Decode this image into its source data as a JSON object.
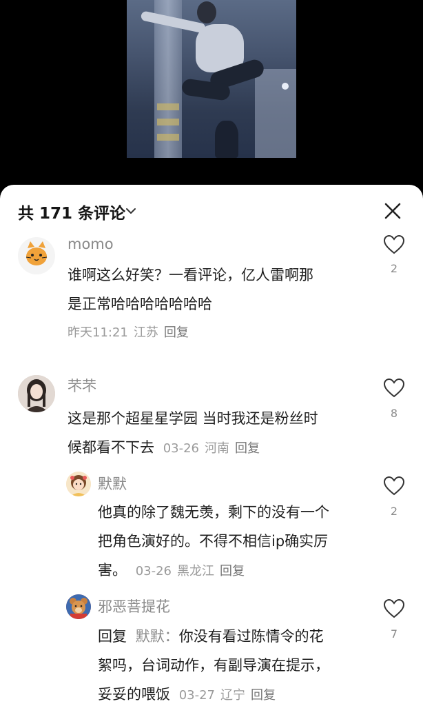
{
  "header": {
    "title": "共 171 条评论"
  },
  "comments": [
    {
      "name": "momo",
      "text_line1": "谁啊这么好笑？一看评论，亿人雷啊那",
      "text_line2": "是正常哈哈哈哈哈哈哈",
      "time": "昨天11:21",
      "location": "江苏",
      "reply": "回复",
      "likes": "2"
    },
    {
      "name": "芣芣",
      "text_line1": "这是那个超星星学园  当时我还是粉丝时",
      "text_line2": "候都看不下去",
      "time": "03-26",
      "location": "河南",
      "reply": "回复",
      "likes": "8"
    },
    {
      "name": "默默",
      "text_line1": "他真的除了魏无羡，剩下的没有一个",
      "text_line2": "把角色演好的。不得不相信ip确实厉",
      "text_line3": "害。",
      "time": "03-26",
      "location": "黑龙江",
      "reply": "回复",
      "likes": "2"
    },
    {
      "name": "邪恶菩提花",
      "reply_prefix": "回复",
      "reply_target": "默默：",
      "text_line1": "你没有看过陈情令的花",
      "text_line2": "絮吗，台词动作，有副导演在提示，",
      "text_line3": "妥妥的喂饭",
      "time": "03-27",
      "location": "辽宁",
      "reply": "回复",
      "likes": "7"
    }
  ],
  "colors": {
    "sheet_bg": "#ffffff",
    "text_primary": "#1e1e1e",
    "text_secondary": "#8a8a8a"
  }
}
